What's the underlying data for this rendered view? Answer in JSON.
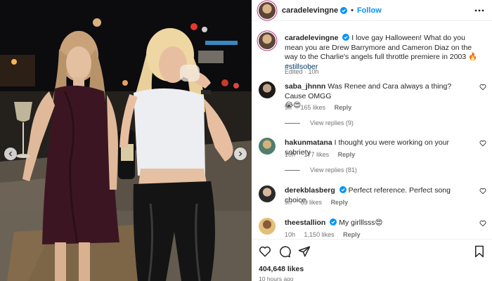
{
  "post": {
    "username": "caradelevingne",
    "follow_label": "Follow",
    "caption_username": "caradelevingne",
    "caption_text": "I love gay Halloween! What do you mean you are Drew Barrymore and Cameron Diaz on the way to the Charlie's angels full throttle premiere in 2003 🔥 ",
    "caption_hashtag": "#stillsober",
    "edited_label": "Edited",
    "edited_time": "10h",
    "likes": "404,648 likes",
    "posted_time": "10 hours ago",
    "colors": {
      "accent": "#0095f6",
      "meta": "#737373",
      "hashtag": "#00376b"
    }
  },
  "comments": [
    {
      "username": "saba_jhnnn",
      "text": "Was Renee and Cara always a thing? Cause OMGG",
      "emoji_line": "😭😍",
      "age": "9h",
      "likes": "165 likes",
      "reply": "Reply",
      "view_replies": "View replies (9)",
      "verified": false
    },
    {
      "username": "hakunmatana",
      "text": "I thought you were working on your sobriety",
      "age": "10h",
      "likes": "177 likes",
      "reply": "Reply",
      "view_replies": "View replies (81)",
      "verified": false
    },
    {
      "username": "derekblasberg",
      "text": "Perfect reference. Perfect song choice.",
      "age": "9h",
      "likes": "63 likes",
      "reply": "Reply",
      "verified": true
    },
    {
      "username": "theestallion",
      "text": "My girlllsss😍",
      "age": "10h",
      "likes": "1,150 likes",
      "reply": "Reply",
      "verified": true
    }
  ],
  "icons": [
    "verified-badge-icon",
    "more-options-icon",
    "heart-icon",
    "comment-icon",
    "share-icon",
    "bookmark-icon",
    "chevron-left-icon",
    "chevron-right-icon"
  ]
}
